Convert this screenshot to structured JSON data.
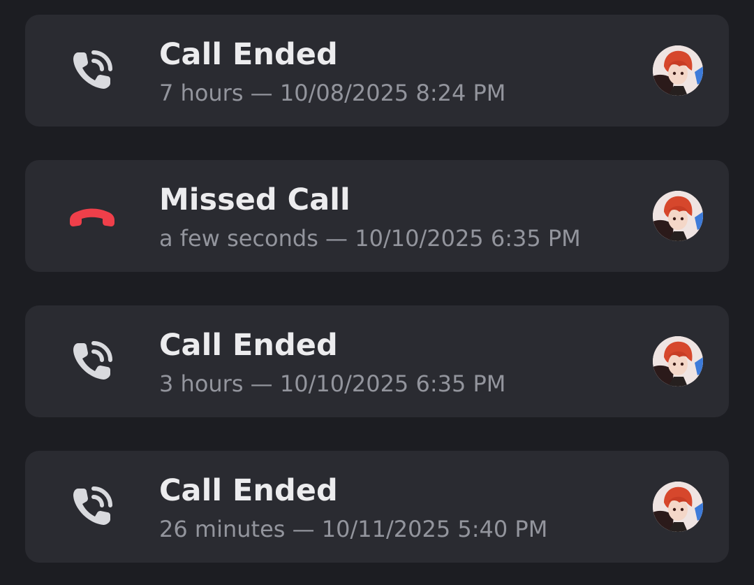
{
  "calls": [
    {
      "status": "Call Ended",
      "duration": "7 hours",
      "separator": "—",
      "datetime": "10/08/2025 8:24 PM",
      "icon": "call-ended-icon"
    },
    {
      "status": "Missed Call",
      "duration": "a few seconds",
      "separator": "—",
      "datetime": "10/10/2025 6:35 PM",
      "icon": "missed-call-icon"
    },
    {
      "status": "Call Ended",
      "duration": "3 hours",
      "separator": "—",
      "datetime": "10/10/2025 6:35 PM",
      "icon": "call-ended-icon"
    },
    {
      "status": "Call Ended",
      "duration": "26 minutes",
      "separator": "—",
      "datetime": "10/11/2025 5:40 PM",
      "icon": "call-ended-icon"
    }
  ],
  "colors": {
    "background": "#1c1d22",
    "card": "#2a2b31",
    "title": "#ececee",
    "meta": "#93959d",
    "call_icon": "#d9dade",
    "missed_icon": "#ef3f4a"
  }
}
